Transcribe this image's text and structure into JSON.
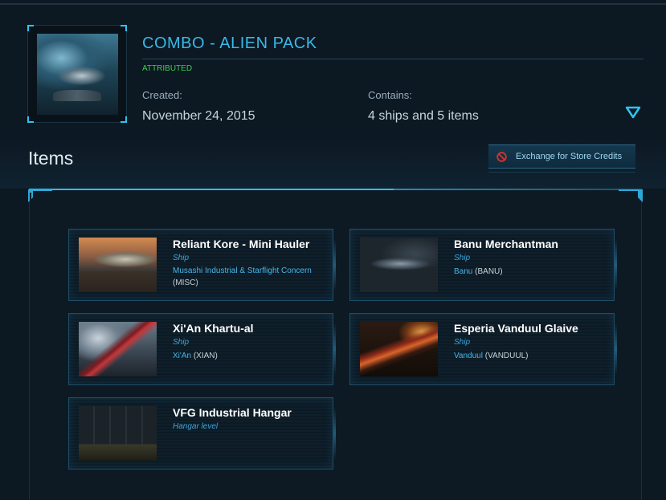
{
  "pledge": {
    "title": "COMBO - ALIEN PACK",
    "status": "ATTRIBUTED",
    "created_label": "Created:",
    "created_value": "November 24, 2015",
    "contains_label": "Contains:",
    "contains_value": "4 ships and 5 items",
    "expand_icon": "chevron-down-icon"
  },
  "items_section": {
    "heading": "Items",
    "exchange_button": "Exchange for Store Credits",
    "exchange_icon": "no-entry-icon"
  },
  "items": [
    {
      "title": "Reliant Kore - Mini Hauler",
      "kind": "Ship",
      "maker": "Musashi Industrial & Starflight Concern",
      "code": "MISC"
    },
    {
      "title": "Banu Merchantman",
      "kind": "Ship",
      "maker": "Banu",
      "code": "BANU"
    },
    {
      "title": "Xi'An Khartu-al",
      "kind": "Ship",
      "maker": "Xi'An",
      "code": "XIAN"
    },
    {
      "title": "Esperia Vanduul Glaive",
      "kind": "Ship",
      "maker": "Vanduul",
      "code": "VANDUUL"
    },
    {
      "title": "VFG Industrial Hangar",
      "kind": "Hangar level",
      "maker": "",
      "code": ""
    }
  ],
  "colors": {
    "accent": "#39b9e8",
    "status_green": "#3ad24c",
    "background": "#0c1822"
  }
}
